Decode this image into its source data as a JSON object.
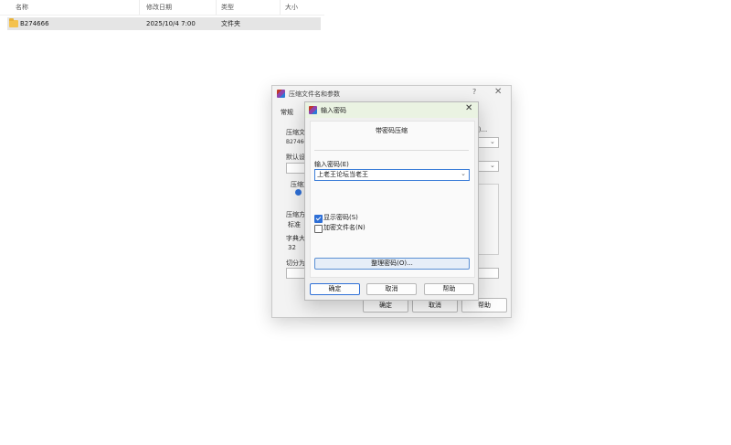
{
  "explorer": {
    "columns": [
      "名称",
      "修改日期",
      "类型",
      "大小"
    ],
    "rows": [
      {
        "name": "B274666",
        "modified": "2025/10/4 7:00",
        "type": "文件夹",
        "size": ""
      }
    ]
  },
  "bg_dialog": {
    "title": "压缩文件名和参数",
    "help": "?",
    "close": "✕",
    "tab": "常规",
    "archive_label": "压缩文",
    "archive_value": "B2746€",
    "browse_suffix": "B)...",
    "default_label": "默认设",
    "format_label": "压缩文",
    "method_label": "压缩方",
    "method_value": "标准",
    "dict_label": "字典大",
    "dict_value": "32",
    "split_label": "切分为",
    "buttons": {
      "ok": "确定",
      "cancel": "取消",
      "help": "帮助"
    }
  },
  "fg_dialog": {
    "title": "输入密码",
    "close": "✕",
    "heading": "带密码压缩",
    "password_label": "输入密码(E)",
    "password_value": "上老王论坛当老王",
    "show_password": "显示密码(S)",
    "encrypt_names": "加密文件名(N)",
    "manage_button": "整理密码(O)...",
    "buttons": {
      "ok": "确定",
      "cancel": "取消",
      "help": "帮助"
    }
  }
}
